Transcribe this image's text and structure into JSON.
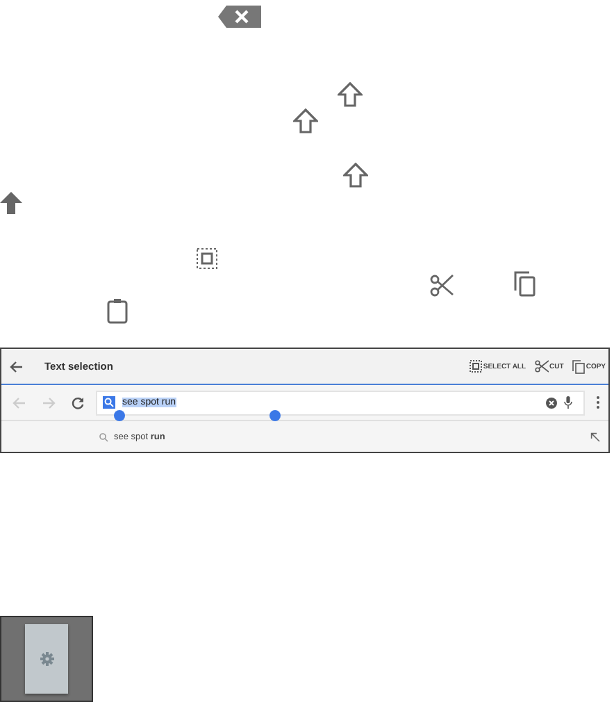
{
  "action_bar": {
    "title": "Text selection",
    "actions": [
      {
        "kind": "select-all",
        "label": "SELECT ALL"
      },
      {
        "kind": "cut",
        "label": "CUT"
      },
      {
        "kind": "copy",
        "label": "COPY"
      }
    ]
  },
  "omnibox": {
    "value": "see spot run",
    "selected": true
  },
  "suggestion": {
    "text": "see spot **run**"
  }
}
